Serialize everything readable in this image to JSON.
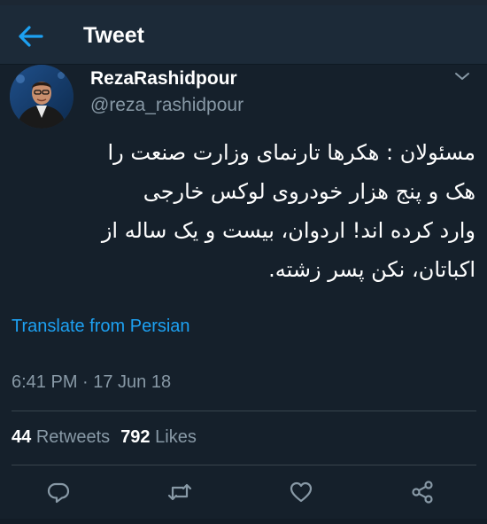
{
  "header": {
    "title": "Tweet",
    "back_icon": "arrow-left-icon",
    "accent": "#1da1f2",
    "bg": "#1c2a38"
  },
  "author": {
    "display_name": "RezaRashidpour",
    "handle": "@reza_rashidpour",
    "avatar_icon": "avatar-photo",
    "more_icon": "chevron-down-icon"
  },
  "tweet": {
    "lines": [
      "مسئولان : هکرها تارنمای وزارت صنعت را",
      "هک  و پنج هزار خودروی لوکس خارجی",
      "وارد کرده اند! اردوان، بیست و یک ساله از",
      "اکباتان، نکن پسر زشته."
    ],
    "translate_label": "Translate from Persian",
    "timestamp": "6:41 PM · 17 Jun 18"
  },
  "stats": {
    "retweets_count": "44",
    "retweets_label": "Retweets",
    "likes_count": "792",
    "likes_label": "Likes"
  },
  "actions": {
    "reply_icon": "reply-icon",
    "retweet_icon": "retweet-icon",
    "like_icon": "heart-icon",
    "share_icon": "share-icon"
  },
  "colors": {
    "background": "#15202b",
    "primary_text": "#ffffff",
    "secondary_text": "#8899a6",
    "link": "#1da1f2",
    "divider": "#38444d"
  }
}
